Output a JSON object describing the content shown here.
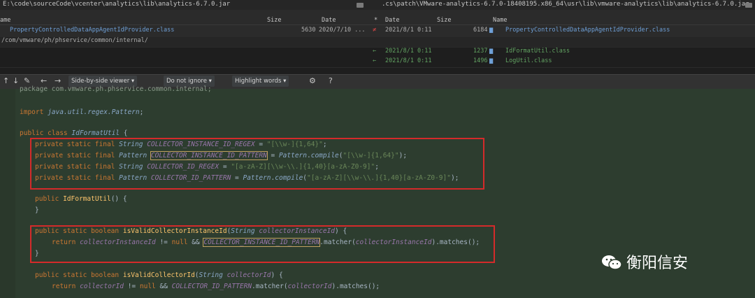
{
  "left_path": "E:\\code\\sourceCode\\vcenter\\analytics\\lib\\analytics-6.7.0.jar",
  "right_path": ".cs\\patch\\VMware-analytics-6.7.0-18408195.x86_64\\usr\\lib\\vmware-analytics\\lib\\analytics-6.7.0.jar",
  "left_headers": {
    "name": "ame",
    "size": "Size",
    "date": "Date"
  },
  "right_headers": {
    "star": "*",
    "date": "Date",
    "size": "Size",
    "name": "Name"
  },
  "rows": [
    {
      "left_name": "PropertyControlledDataAppAgentIdProvider.class",
      "left_size": "5630",
      "left_date": "2020/7/10 ...",
      "marker": "≠",
      "right_date": "2021/8/1 0:11",
      "right_size": "6184",
      "right_name": "PropertyControlledDataAppAgentIdProvider.class"
    },
    {
      "left_name": "/com/vmware/ph/phservice/common/internal/"
    },
    {
      "marker": "←",
      "right_date": "2021/8/1 0:11",
      "right_size": "1237",
      "right_name": "IdFormatUtil.class"
    },
    {
      "marker": "←",
      "right_date": "2021/8/1 0:11",
      "right_size": "1496",
      "right_name": "LogUtil.class"
    }
  ],
  "toolbar": {
    "viewer": "Side-by-side viewer",
    "ignore": "Do not ignore",
    "highlight": "Highlight words",
    "help": "?"
  },
  "code": {
    "l0": "package com.vmware.ph.phservice.common.internal;",
    "import_kw": "import",
    "import_path": "java.util.regex.Pattern",
    "class_kw": "public class",
    "class_name": "IdFormatUtil",
    "psf": "private static final",
    "string_t": "String",
    "pattern_t": "Pattern",
    "c1": "COLLECTOR_INSTANCE_ID_REGEX",
    "c1v": "\"[\\\\w-]{1,64}\"",
    "c2": "COLLECTOR_INSTANCE_ID_PATTERN",
    "c2v": "\"[\\\\w-]{1,64}\"",
    "c3": "COLLECTOR_ID_REGEX",
    "c3v": "\"[a-zA-Z][\\\\w-\\\\.]{1,40}[a-zA-Z0-9]\"",
    "c4": "COLLECTOR_ID_PATTERN",
    "c4v": "\"[a-zA-Z][\\\\w-\\\\.]{1,40}[a-zA-Z0-9]\"",
    "compile": "compile",
    "ctor": "IdFormatUtil",
    "m1": "isValidCollectorInstanceId",
    "p1": "collectorInstanceId",
    "m2": "isValidCollectorId",
    "p2": "collectorId",
    "pub": "public",
    "psb": "public static boolean",
    "ret": "return",
    "null": "null",
    "matcher": "matcher",
    "matches": "matches",
    "close": "}"
  },
  "watermark": "衡阳信安"
}
